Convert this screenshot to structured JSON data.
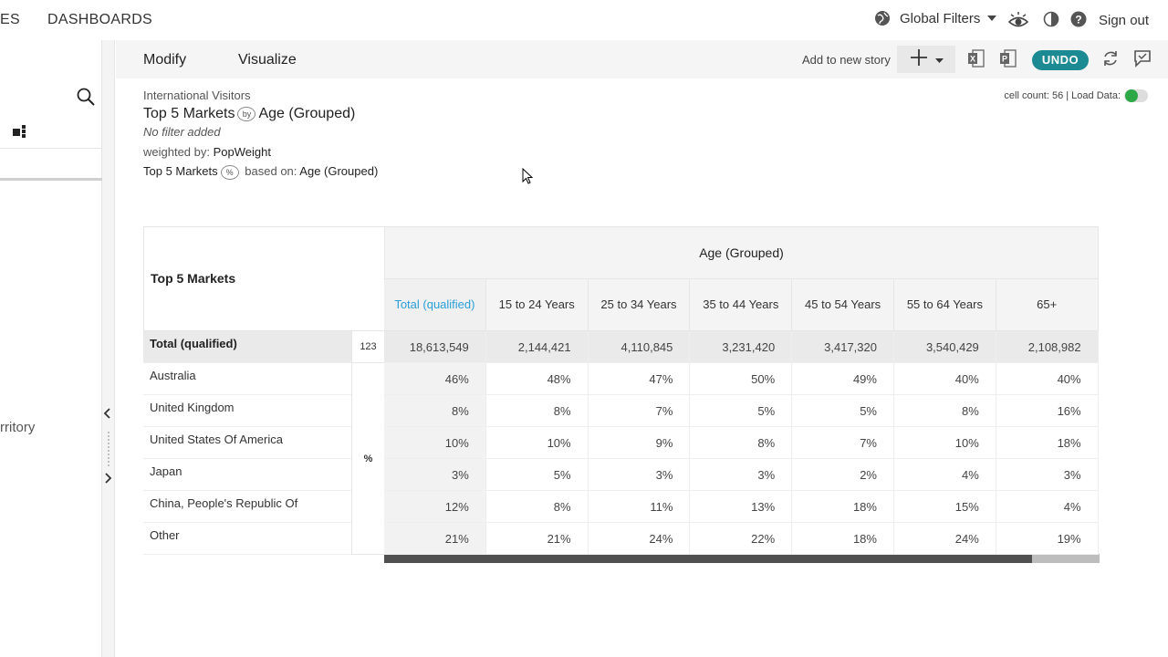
{
  "nav": {
    "left_items": [
      "ES",
      "DASHBOARDS"
    ],
    "global_filters": "Global Filters",
    "sign_out": "Sign out",
    "icons": [
      "globe-icon",
      "chevron-down-icon",
      "eye-icon",
      "contrast-icon",
      "help-icon"
    ]
  },
  "sidebar": {
    "label_partial": "rritory",
    "icons": [
      "search-icon",
      "grid-icon",
      "chevron-left-icon",
      "chevron-right-icon"
    ]
  },
  "toolbar": {
    "tabs": [
      "Modify",
      "Visualize"
    ],
    "add_story": "Add to new story",
    "undo": "UNDO",
    "icons": [
      "plus-icon",
      "chevron-down-icon",
      "excel-icon",
      "powerpoint-icon",
      "refresh-icon",
      "comment-icon"
    ]
  },
  "report": {
    "dataset": "International Visitors",
    "title_rows": "Top 5 Markets",
    "title_by": "by",
    "title_cols": "Age (Grouped)",
    "filter": "No filter added",
    "weighted_label": "weighted by:",
    "weight": "PopWeight",
    "pct_rows": "Top 5 Markets",
    "pct_icon": "%",
    "based_label": "based on:",
    "based_on": "Age (Grouped)",
    "cell_count": "cell count: 56 | Load Data:"
  },
  "table": {
    "row_header": "Top 5 Markets",
    "col_group": "Age (Grouped)",
    "columns": [
      "Total (qualified)",
      "15 to 24 Years",
      "25 to 34 Years",
      "35 to 44 Years",
      "45 to 54 Years",
      "55 to 64 Years",
      "65+"
    ],
    "total_row": {
      "label": "Total (qualified)",
      "unit": "123",
      "values": [
        "18,613,549",
        "2,144,421",
        "4,110,845",
        "3,231,420",
        "3,417,320",
        "3,540,429",
        "2,108,982"
      ]
    },
    "pct_unit": "%",
    "rows": [
      {
        "label": "Australia",
        "values": [
          "46%",
          "48%",
          "47%",
          "50%",
          "49%",
          "40%",
          "40%"
        ]
      },
      {
        "label": "United Kingdom",
        "values": [
          "8%",
          "8%",
          "7%",
          "5%",
          "5%",
          "8%",
          "16%"
        ]
      },
      {
        "label": "United States Of America",
        "values": [
          "10%",
          "10%",
          "9%",
          "8%",
          "7%",
          "10%",
          "18%"
        ]
      },
      {
        "label": "Japan",
        "values": [
          "3%",
          "5%",
          "3%",
          "3%",
          "2%",
          "4%",
          "3%"
        ]
      },
      {
        "label": "China, People's Republic Of",
        "values": [
          "12%",
          "8%",
          "11%",
          "13%",
          "18%",
          "15%",
          "4%"
        ]
      },
      {
        "label": "Other",
        "values": [
          "21%",
          "21%",
          "24%",
          "22%",
          "18%",
          "24%",
          "19%"
        ]
      }
    ]
  },
  "colors": {
    "accent_teal": "#1c8a92",
    "link_blue": "#2a9fd8",
    "toggle_green": "#2ca845"
  }
}
